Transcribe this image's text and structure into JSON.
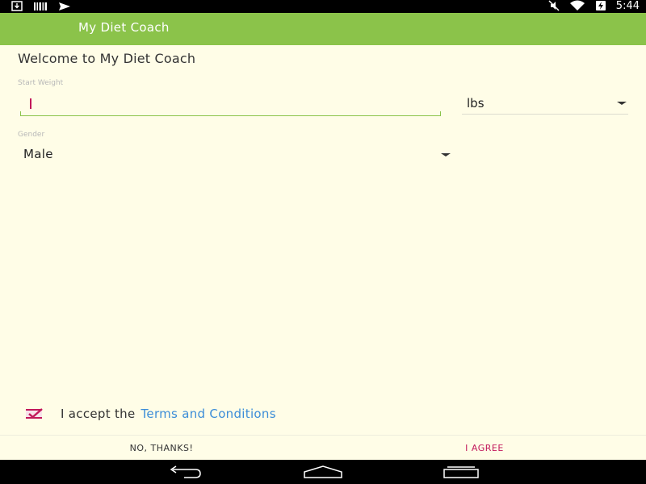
{
  "status_bar": {
    "time": "5:44",
    "left_icons": [
      "download-icon",
      "barcode-icon",
      "send-icon"
    ],
    "right_icons": [
      "mute-icon",
      "wifi-icon",
      "battery-charging-icon"
    ]
  },
  "app_bar": {
    "title": "My Diet Coach",
    "color": "#8bc34a"
  },
  "form": {
    "welcome": "Welcome to My Diet Coach",
    "start_weight_label": "Start Weight",
    "start_weight_value": "",
    "unit_selected": "lbs",
    "gender_label": "Gender",
    "gender_selected": "Male"
  },
  "terms": {
    "checked": true,
    "prefix": "I accept the",
    "link_text": "Terms and Conditions"
  },
  "buttons": {
    "decline": "NO, THANKS!",
    "agree": "I AGREE",
    "accent": "#c2185b"
  },
  "nav_bar": {
    "icons": [
      "back-icon",
      "home-icon",
      "recents-icon"
    ]
  }
}
